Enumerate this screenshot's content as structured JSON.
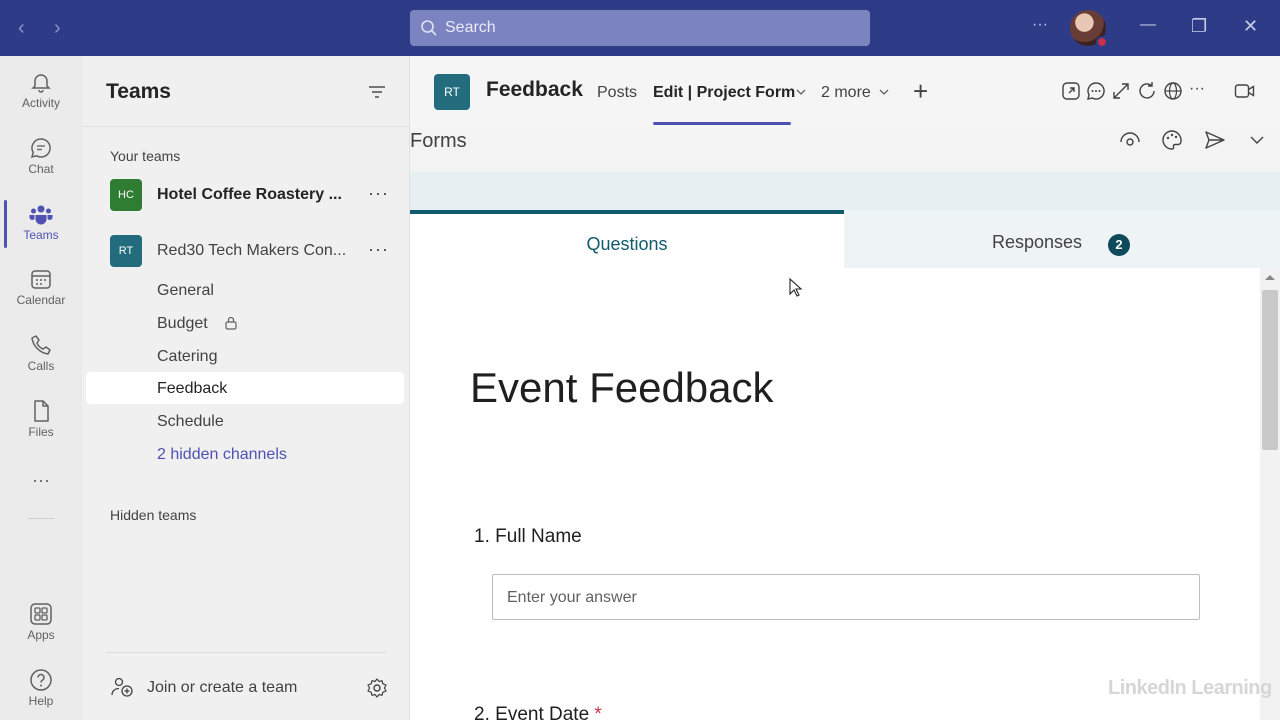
{
  "titlebar": {
    "search_placeholder": "Search",
    "back_label": "‹",
    "forward_label": "›",
    "more_label": "···",
    "minimize_label": "—",
    "restore_label": "❐",
    "close_label": "✕"
  },
  "rail": {
    "items": [
      {
        "label": "Activity",
        "icon": "bell-icon"
      },
      {
        "label": "Chat",
        "icon": "chat-icon"
      },
      {
        "label": "Teams",
        "icon": "teams-icon"
      },
      {
        "label": "Calendar",
        "icon": "calendar-icon"
      },
      {
        "label": "Calls",
        "icon": "phone-icon"
      },
      {
        "label": "Files",
        "icon": "file-icon"
      }
    ],
    "more_label": "···",
    "apps_label": "Apps",
    "help_label": "Help"
  },
  "panel": {
    "title": "Teams",
    "your_teams_label": "Your teams",
    "teams": [
      {
        "initials": "HC",
        "name": "Hotel Coffee Roastery ...",
        "color": "#2e7d32"
      },
      {
        "initials": "RT",
        "name": "Red30 Tech Makers Con...",
        "color": "#226c7e"
      }
    ],
    "channels": [
      "General",
      "Budget",
      "Catering",
      "Feedback",
      "Schedule"
    ],
    "hidden_channels_label": "2 hidden channels",
    "hidden_teams_label": "Hidden teams",
    "join_label": "Join or create a team",
    "more_label": "···"
  },
  "header": {
    "avatar": "RT",
    "title": "Feedback",
    "tabs": [
      "Posts",
      "Edit | Project Form",
      "2 more"
    ],
    "add_label": "+"
  },
  "forms": {
    "app_title": "Forms",
    "questions_tab": "Questions",
    "responses_tab": "Responses",
    "responses_count": "2",
    "form_title": "Event Feedback",
    "q1_number": "1.",
    "q1_label": "Full Name",
    "q1_placeholder": "Enter your answer",
    "q2_number": "2.",
    "q2_label": "Event Date",
    "q2_required": "*"
  },
  "watermark": "LinkedIn Learning",
  "colors": {
    "titlebar": "#2e3c88",
    "accent": "#4f52b2",
    "forms_teal": "#0f5a6b"
  }
}
